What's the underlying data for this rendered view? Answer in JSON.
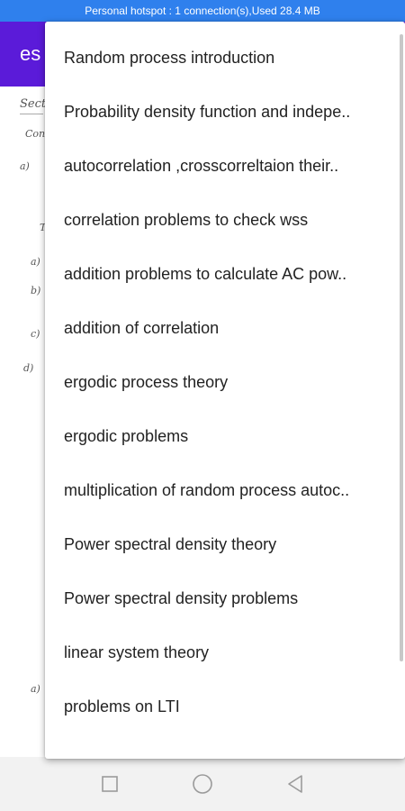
{
  "status_bar": {
    "text": "Personal hotspot : 1 connection(s),Used  28.4 MB"
  },
  "app_bar": {
    "title": "es"
  },
  "notes": {
    "n1": "Sect",
    "n2": "Conv",
    "n3": "a)",
    "n4": "T",
    "n5": "a)",
    "n6": "b)",
    "n7": "c)",
    "n8": "d)",
    "n9": "a)"
  },
  "menu": {
    "items": [
      {
        "label": "Random process introduction"
      },
      {
        "label": "Probability density function and indepe.."
      },
      {
        "label": "autocorrelation ,crosscorreltaion their.."
      },
      {
        "label": "correlation problems to check wss"
      },
      {
        "label": "addition problems to calculate AC pow.."
      },
      {
        "label": "addition of correlation"
      },
      {
        "label": "ergodic process theory"
      },
      {
        "label": "ergodic problems"
      },
      {
        "label": "multiplication of random process autoc.."
      },
      {
        "label": "Power spectral density theory"
      },
      {
        "label": "Power spectral density problems"
      },
      {
        "label": "linear system theory"
      },
      {
        "label": "problems on LTI"
      }
    ]
  },
  "nav_bar": {
    "icons": [
      "square-icon",
      "circle-icon",
      "triangle-back-icon"
    ]
  }
}
